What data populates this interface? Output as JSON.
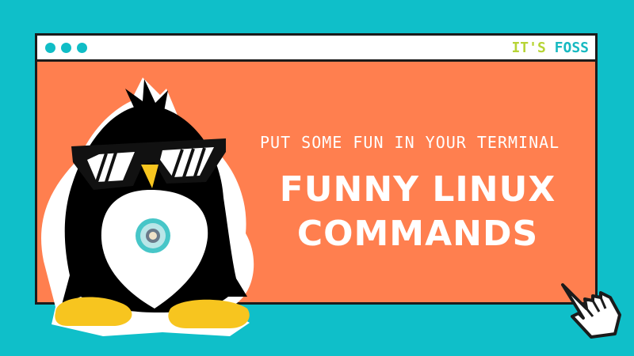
{
  "window": {
    "brand": {
      "its": "IT'S",
      "foss": "FOSS"
    }
  },
  "banner": {
    "tagline": "PUT SOME FUN IN YOUR TERMINAL",
    "title_line1": "FUNNY LINUX",
    "title_line2": "COMMANDS"
  },
  "colors": {
    "background": "#0fbfc9",
    "panel": "#ff7f4f",
    "titlebar": "#ffffff",
    "dots": "#10bdc6",
    "text": "#ffffff",
    "penguin_body": "#000000",
    "feet_beak": "#f7c51f"
  },
  "icons": [
    "titlebar-dot",
    "penguin-mascot-icon",
    "sunglasses-icon",
    "pointing-hand-cursor-icon"
  ]
}
